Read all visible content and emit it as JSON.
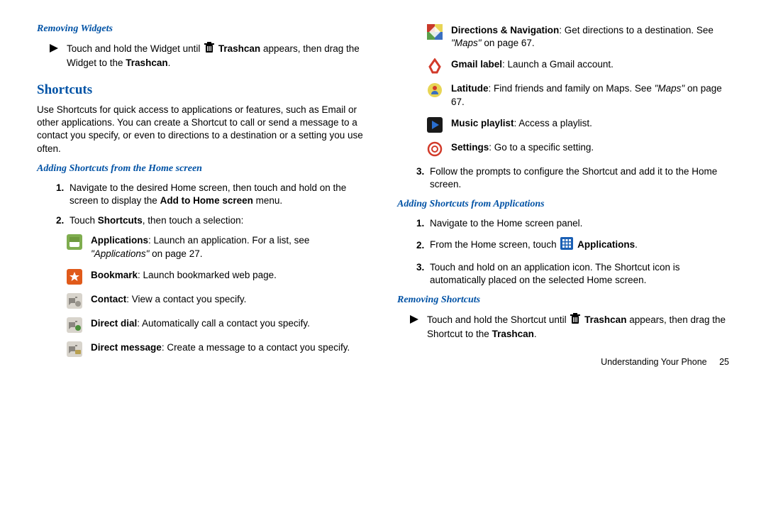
{
  "left": {
    "h_remove_widgets": "Removing Widgets",
    "remove_widgets_a": "Touch and hold the Widget until ",
    "trashcan_b": " Trashcan",
    "remove_widgets_b": " appears, then drag the Widget to the ",
    "remove_widgets_c": "Trashcan",
    "dot": ".",
    "h_shortcuts": "Shortcuts",
    "shortcuts_intro": "Use Shortcuts for quick access to applications or features, such as Email or other applications. You can create a Shortcut to call or send a message to a contact you specify, or even to directions to a destination or a setting you use often.",
    "h_add_home": "Adding Shortcuts from the Home screen",
    "li1a": "Navigate to the desired Home screen, then touch and hold on the screen to display the ",
    "li1b": "Add to Home screen",
    "li1c": " menu.",
    "li2a": "Touch ",
    "li2b": "Shortcuts",
    "li2c": ", then touch a selection:",
    "apps_a": "Applications",
    "apps_b": ": Launch an application. For a list, see ",
    "apps_c": "\"Applications\"",
    "apps_d": " on page 27.",
    "bookmark_a": "Bookmark",
    "bookmark_b": ": Launch bookmarked web page.",
    "contact_a": "Contact",
    "contact_b": ": View a contact you specify.",
    "dial_a": "Direct dial",
    "dial_b": ": Automatically call a contact you specify.",
    "msg_a": "Direct message",
    "msg_b": ": Create a message to a contact you specify."
  },
  "right": {
    "dir_a": "Directions & Navigation",
    "dir_b": ": Get directions to a destination. See ",
    "dir_c": "\"Maps\"",
    "dir_d": " on page 67.",
    "gmail_a": "Gmail label",
    "gmail_b": ": Launch a Gmail account.",
    "lat_a": "Latitude",
    "lat_b": ": Find friends and family on Maps. See ",
    "lat_c": "\"Maps\"",
    "lat_d": " on page 67.",
    "music_a": "Music playlist",
    "music_b": ": Access a playlist.",
    "set_a": "Settings",
    "set_b": ": Go to a specific setting.",
    "li3": "Follow the prompts to configure the Shortcut and add it to the Home screen.",
    "h_add_apps": "Adding Shortcuts from Applications",
    "a1": "Navigate to the Home screen panel.",
    "a2a": "From the Home screen, touch ",
    "a2b": " Applications",
    "a2c": ".",
    "a3": "Touch and hold on an application icon. The Shortcut icon is automatically placed on the selected Home screen.",
    "h_remove_sc": "Removing Shortcuts",
    "rs_a": "Touch and hold the Shortcut until ",
    "rs_b": " Trashcan",
    "rs_c": " appears, then drag the Shortcut to the ",
    "rs_d": "Trashcan",
    "footer_text": "Understanding Your Phone",
    "page": "25"
  }
}
